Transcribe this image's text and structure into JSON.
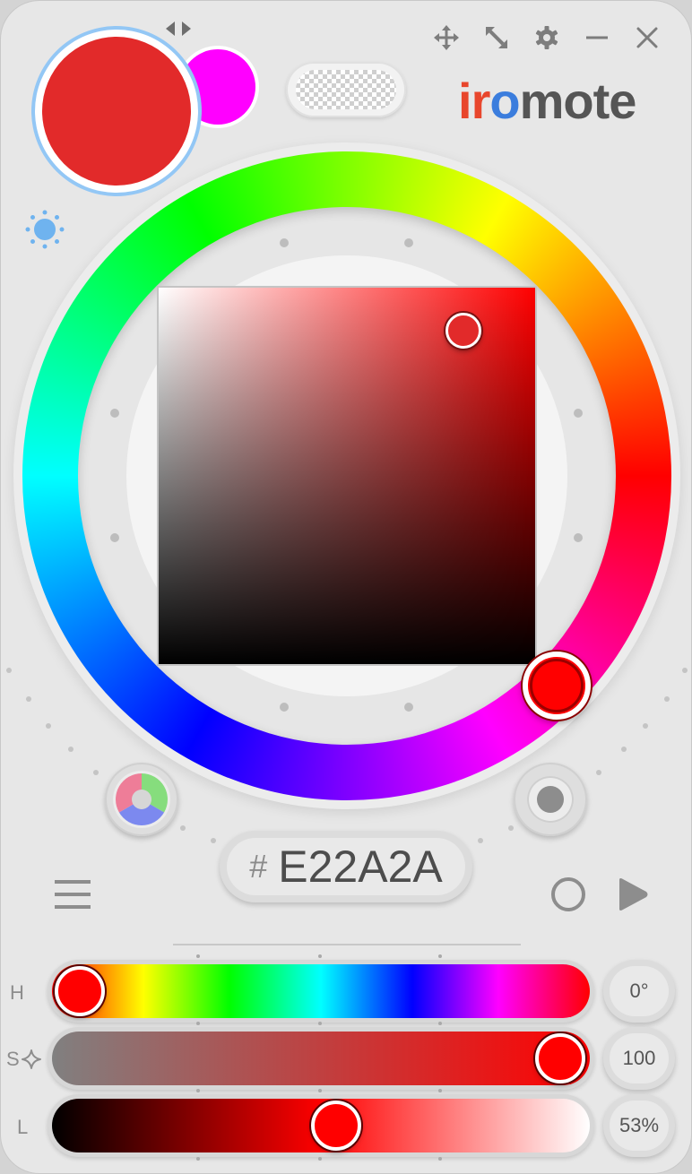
{
  "app": {
    "logo_text": [
      "i",
      "r",
      "o",
      "mote"
    ]
  },
  "titlebar": {
    "move_icon": "move-icon",
    "resize_icon": "resize-icon",
    "settings_icon": "gear-icon",
    "minimize_icon": "minimize-icon",
    "close_icon": "close-icon"
  },
  "colors": {
    "primary": "#e22a2a",
    "secondary": "#ff00ff",
    "hue_pointer": "#ff0000",
    "accent_ring": "#93c7f5"
  },
  "hex": {
    "hash": "#",
    "value": "E22A2A"
  },
  "sliders": {
    "hue": {
      "label": "H",
      "value_text": "0°",
      "value": 0,
      "max": 360
    },
    "saturation": {
      "label": "S",
      "value_text": "100",
      "value": 100,
      "max": 100
    },
    "lightness": {
      "label": "L",
      "value_text": "53%",
      "value": 53,
      "max": 100
    }
  }
}
